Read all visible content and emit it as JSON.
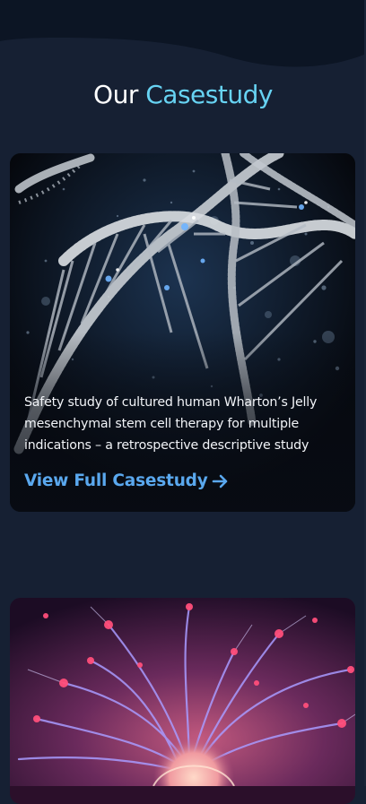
{
  "header": {
    "title_part1": "Our",
    "title_part2": "Casestudy",
    "accent_color": "#67d3f3"
  },
  "cards": [
    {
      "image": "dna-double-helix-image",
      "description": "Safety study of cultured human Wharton’s Jelly mesenchymal stem cell therapy for multiple indications – a retrospective descriptive study",
      "link_label": "View Full Casestudy",
      "link_icon": "arrow-right-icon",
      "link_color": "#5aa8ee"
    },
    {
      "image": "neuron-network-image"
    }
  ]
}
